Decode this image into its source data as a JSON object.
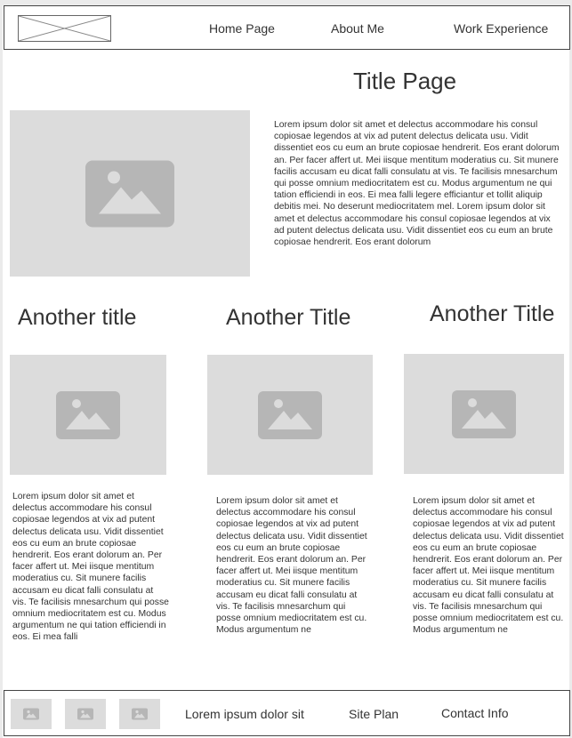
{
  "nav": {
    "items": [
      {
        "label": "Home Page"
      },
      {
        "label": "About Me"
      },
      {
        "label": "Work Experience"
      }
    ]
  },
  "hero": {
    "title": "Title Page",
    "body": "Lorem ipsum dolor sit amet et delectus accommodare his consul copiosae legendos at vix ad putent delectus delicata usu. Vidit dissentiet eos cu eum an brute copiosae hendrerit. Eos erant dolorum an. Per facer affert ut. Mei iisque mentitum moderatius cu. Sit munere facilis accusam eu dicat falli consulatu at vis. Te facilisis mnesarchum qui posse omnium mediocritatem est cu. Modus argumentum ne qui tation efficiendi in eos. Ei mea falli legere efficiantur et tollit aliquip debitis mei. No deserunt mediocritatem mel. Lorem ipsum dolor sit amet et delectus accommodare his consul copiosae legendos at vix ad putent delectus delicata usu. Vidit dissentiet eos cu eum an brute copiosae hendrerit. Eos erant dolorum"
  },
  "columns": [
    {
      "title": "Another title",
      "body": "Lorem ipsum dolor sit amet et delectus accommodare his consul copiosae legendos at vix ad putent delectus delicata usu. Vidit dissentiet eos cu eum an brute copiosae hendrerit. Eos erant dolorum an. Per facer affert ut. Mei iisque mentitum moderatius cu. Sit munere facilis accusam eu dicat falli consulatu at vis. Te facilisis mnesarchum qui posse omnium mediocritatem est cu. Modus argumentum ne qui tation efficiendi in eos. Ei mea falli"
    },
    {
      "title": "Another Title",
      "body": "Lorem ipsum dolor sit amet et delectus accommodare his consul copiosae legendos at vix ad putent delectus delicata usu. Vidit dissentiet eos cu eum an brute copiosae hendrerit. Eos erant dolorum an. Per facer affert ut. Mei iisque mentitum moderatius cu. Sit munere facilis accusam eu dicat falli consulatu at vis. Te facilisis mnesarchum qui posse omnium mediocritatem est cu. Modus argumentum ne"
    },
    {
      "title": "Another Title",
      "body": "Lorem ipsum dolor sit amet et delectus accommodare his consul copiosae legendos at vix ad putent delectus delicata usu. Vidit dissentiet eos cu eum an brute copiosae hendrerit. Eos erant dolorum an. Per facer affert ut. Mei iisque mentitum moderatius cu. Sit munere facilis accusam eu dicat falli consulatu at vis. Te facilisis mnesarchum qui posse omnium mediocritatem est cu. Modus argumentum ne"
    }
  ],
  "footer": {
    "text": "Lorem ipsum dolor sit",
    "site_plan": "Site Plan",
    "contact": "Contact Info"
  },
  "icons": {
    "image_placeholder": "image-icon",
    "logo_placeholder": "logo-placeholder-icon"
  },
  "colors": {
    "placeholder_bg": "#dcdcdc",
    "placeholder_glyph": "#b6b6b6",
    "border": "#444444",
    "text": "#333333"
  }
}
